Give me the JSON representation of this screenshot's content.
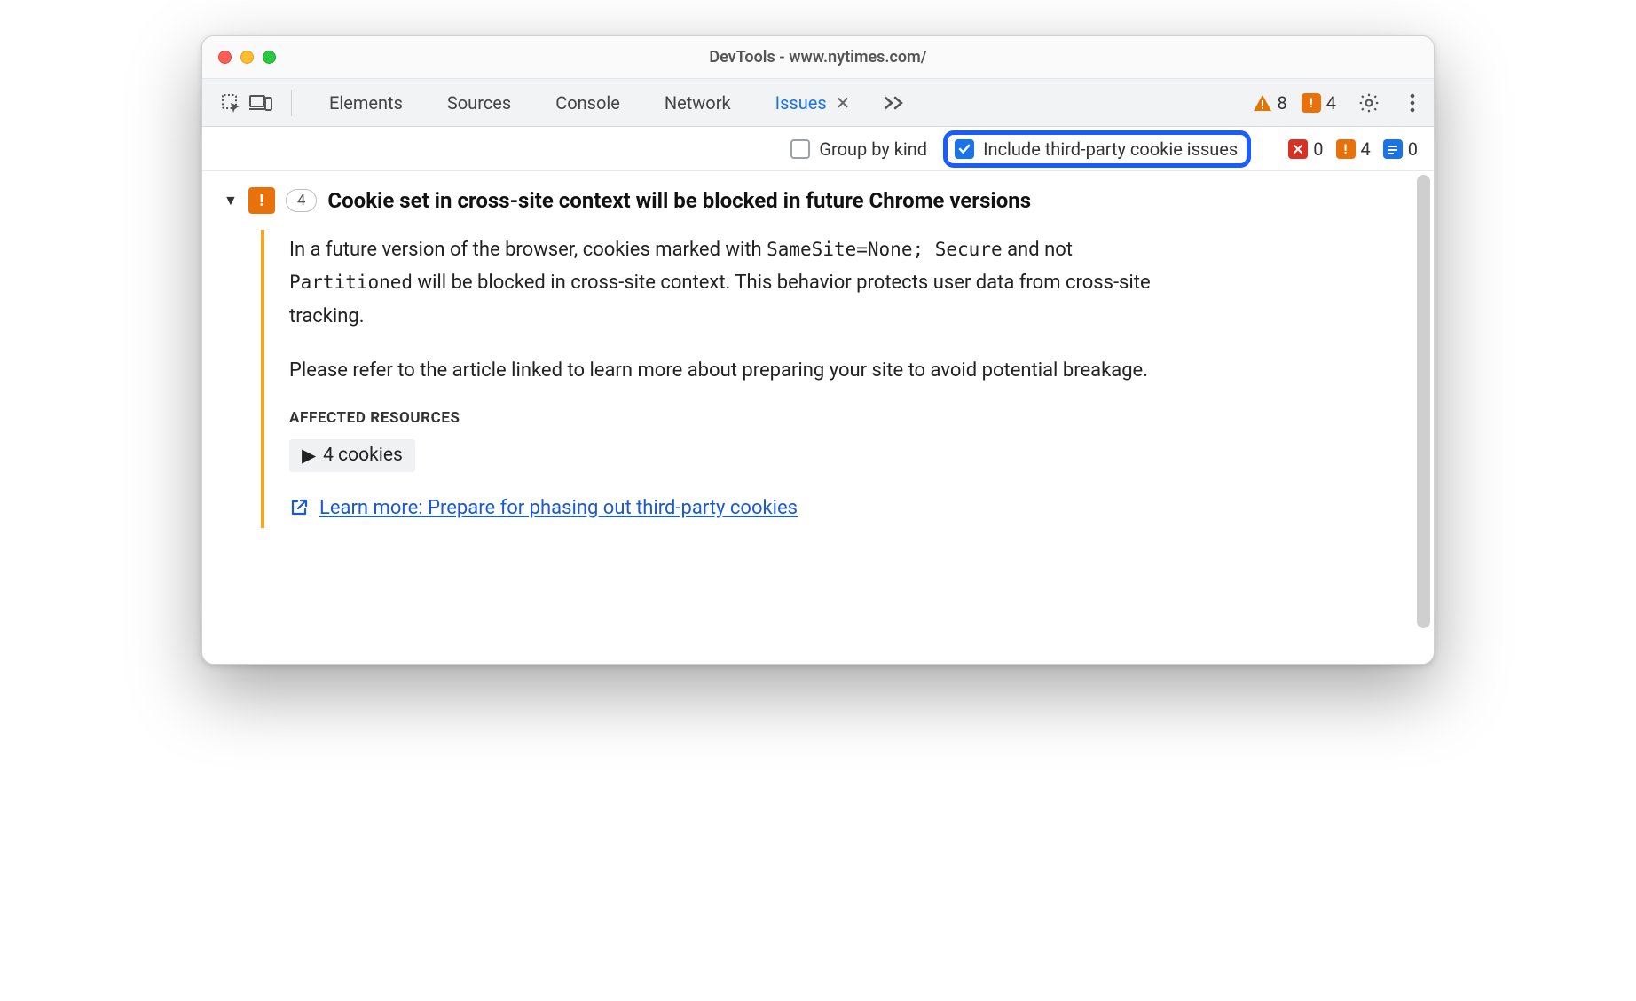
{
  "window": {
    "title": "DevTools - www.nytimes.com/"
  },
  "tabs": {
    "elements": "Elements",
    "sources": "Sources",
    "console": "Console",
    "network": "Network",
    "issues": "Issues"
  },
  "top_badges": {
    "warnings_count": "8",
    "issues_count": "4"
  },
  "filters": {
    "group_by_kind": "Group by kind",
    "include_3p": "Include third-party cookie issues"
  },
  "filter_counts": {
    "errors": "0",
    "warnings": "4",
    "info": "0"
  },
  "issue": {
    "badge_count": "4",
    "title": "Cookie set in cross-site context will be blocked in future Chrome versions",
    "para1_before": "In a future version of the browser, cookies marked with ",
    "code1": "SameSite=None; Secure",
    "para1_mid": " and not ",
    "code2": "Partitioned",
    "para1_after": " will be blocked in cross-site context. This behavior protects user data from cross-site tracking.",
    "para2": "Please refer to the article linked to learn more about preparing your site to avoid potential breakage.",
    "affected_heading": "AFFECTED RESOURCES",
    "cookies_label": "4 cookies",
    "learn_more": "Learn more: Prepare for phasing out third-party cookies"
  }
}
